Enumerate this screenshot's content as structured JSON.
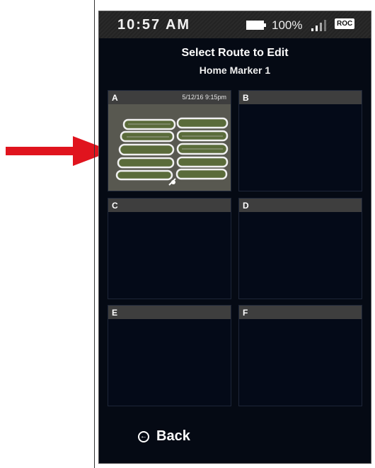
{
  "status_bar": {
    "time": "10:57 AM",
    "battery_percent": "100%",
    "carrier_badge": "ROC",
    "battery_level": 1.0
  },
  "header": {
    "title": "Select Route to Edit",
    "subtitle": "Home Marker 1"
  },
  "routes": [
    {
      "letter": "A",
      "date": "5/12/16 9:15pm",
      "has_preview": true
    },
    {
      "letter": "B",
      "date": "",
      "has_preview": false
    },
    {
      "letter": "C",
      "date": "",
      "has_preview": false
    },
    {
      "letter": "D",
      "date": "",
      "has_preview": false
    },
    {
      "letter": "E",
      "date": "",
      "has_preview": false
    },
    {
      "letter": "F",
      "date": "",
      "has_preview": false
    }
  ],
  "footer": {
    "back_label": "Back"
  },
  "colors": {
    "annotation_arrow": "#e0141e",
    "screen_background": "#050a14",
    "tile_header": "#3e3e3e"
  },
  "icons": {
    "back": "circle-arrow-left-icon",
    "battery": "battery-icon",
    "signal": "signal-bars-icon"
  }
}
